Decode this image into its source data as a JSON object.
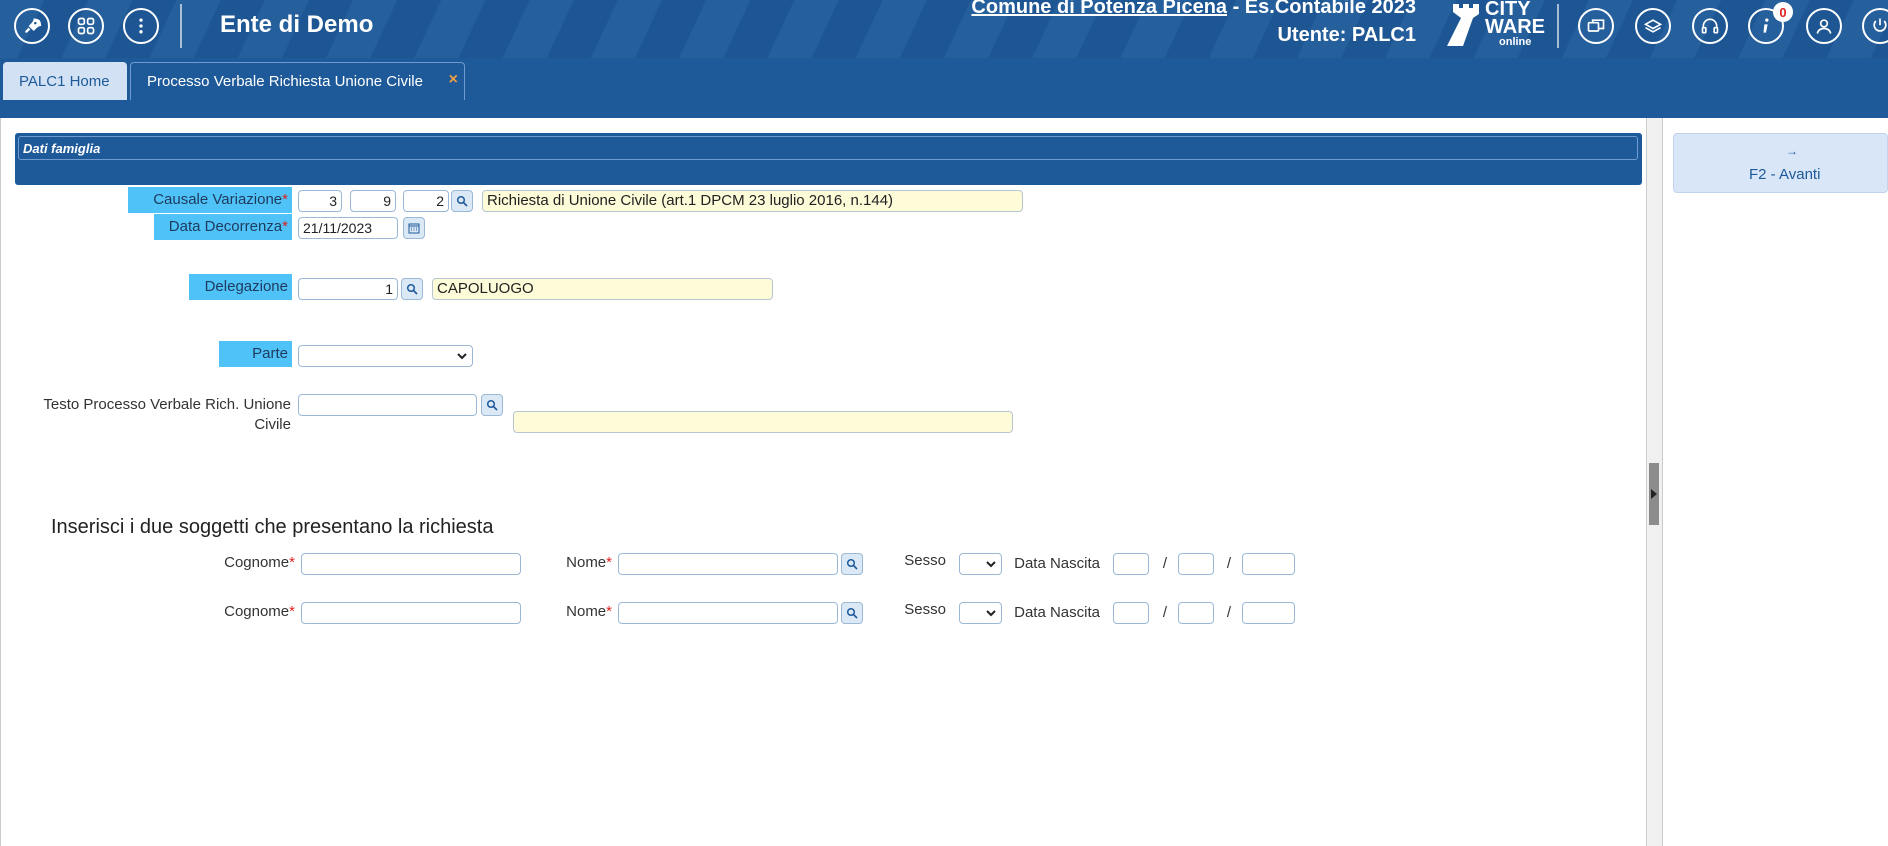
{
  "header": {
    "app_title": "Ente di Demo",
    "comune_label": "Comune di Potenza Picena",
    "es_contabile_label": " - Es.Contabile 2023",
    "utente_label": "Utente: PALC1",
    "logo": {
      "line1": "CITY",
      "line2": "WARE",
      "line3": "online"
    },
    "notification_count": "0",
    "left_icons": [
      "rocket-icon",
      "apps-grid-icon",
      "more-vertical-icon"
    ],
    "right_icons": [
      "windows-icon",
      "layers-icon",
      "headset-icon",
      "info-icon",
      "user-icon",
      "power-icon"
    ]
  },
  "tabs": [
    {
      "label": "PALC1 Home",
      "active": false
    },
    {
      "label": "Processo Verbale Richiesta Unione Civile",
      "active": true,
      "close": "×"
    }
  ],
  "section": {
    "title": "Dati famiglia"
  },
  "form": {
    "causale": {
      "label": "Causale Variazione",
      "required": "*",
      "v1": "3",
      "v2": "9",
      "v3": "2",
      "description": "Richiesta di Unione Civile (art.1 DPCM 23 luglio 2016, n.144)"
    },
    "data_decorrenza": {
      "label": "Data Decorrenza",
      "required": "*",
      "value": "21/11/2023"
    },
    "delegazione": {
      "label": "Delegazione",
      "value": "1",
      "description": "CAPOLUOGO"
    },
    "parte": {
      "label": "Parte",
      "value": ""
    },
    "testo": {
      "label_line1": "Testo Processo Verbale Rich. Unione",
      "label_line2": "Civile",
      "value": "",
      "description": ""
    }
  },
  "soggetti": {
    "heading": "Inserisci i due soggetti che presentano la richiesta",
    "rows": [
      {
        "cognome_label": "Cognome",
        "nome_label": "Nome",
        "required": "*",
        "sesso_label": "Sesso",
        "data_nascita_label": "Data Nascita",
        "sep": "/"
      },
      {
        "cognome_label": "Cognome",
        "nome_label": "Nome",
        "required": "*",
        "sesso_label": "Sesso",
        "data_nascita_label": "Data Nascita",
        "sep": "/"
      }
    ]
  },
  "right_panel": {
    "avanti_label": "F2 - Avanti",
    "avanti_arrow": "→"
  },
  "colors": {
    "header_blue": "#1e5a99",
    "label_highlight": "#4fc3f7",
    "description_bg": "#fdfbd8",
    "required": "#dd2222"
  }
}
